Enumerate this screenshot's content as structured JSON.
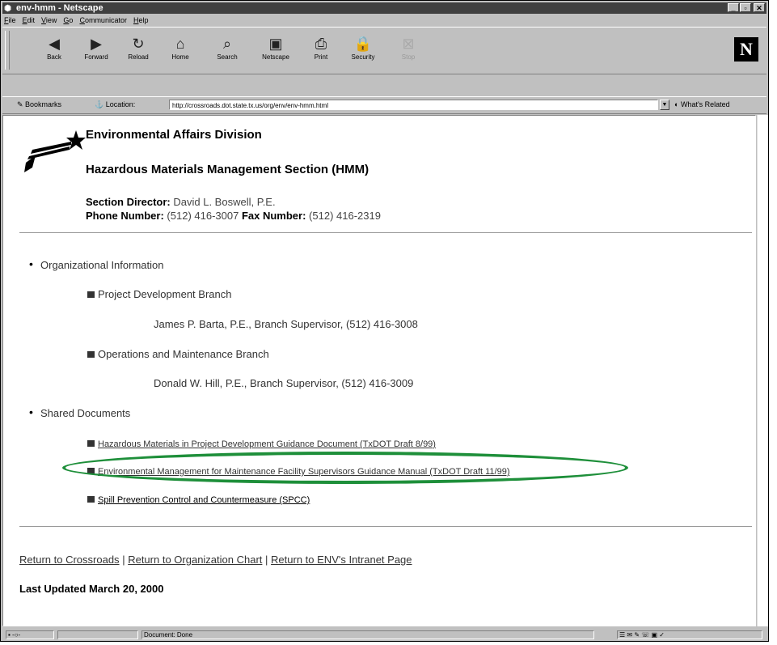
{
  "window": {
    "title": "env-hmm - Netscape",
    "controls": {
      "minimize": "_",
      "maximize": "▫",
      "close": "✕"
    }
  },
  "menu": [
    "File",
    "Edit",
    "View",
    "Go",
    "Communicator",
    "Help"
  ],
  "toolbar": [
    {
      "label": "Back",
      "icon": "◀"
    },
    {
      "label": "Forward",
      "icon": "▶"
    },
    {
      "label": "Reload",
      "icon": "↻"
    },
    {
      "label": "Home",
      "icon": "⌂"
    },
    {
      "label": "Search",
      "icon": "⌕"
    },
    {
      "label": "Netscape",
      "icon": "▣"
    },
    {
      "label": "Print",
      "icon": "⎙"
    },
    {
      "label": "Security",
      "icon": "🔒"
    },
    {
      "label": "Stop",
      "icon": "⊠"
    }
  ],
  "logo": "N",
  "location": {
    "bookmarks_label": "Bookmarks",
    "location_label": "Location:",
    "url": "http://crossroads.dot.state.tx.us/org/env/env-hmm.html",
    "whats_related": "What's Related"
  },
  "page": {
    "division": "Environmental Affairs Division",
    "section": "Hazardous Materials Management Section (HMM)",
    "director_label": "Section Director:",
    "director": "David L. Boswell, P.E.",
    "phone_label": "Phone Number:",
    "phone": "(512) 416-3007",
    "fax_label": "Fax Number:",
    "fax": "(512) 416-2319",
    "org_info": "Organizational Information",
    "branch1": "Project Development Branch",
    "branch1_contact": "James P. Barta, P.E., Branch Supervisor, (512) 416-3008",
    "branch2": "Operations and Maintenance Branch",
    "branch2_contact": "Donald W. Hill, P.E., Branch Supervisor, (512) 416-3009",
    "shared_docs": "Shared Documents",
    "doc1": "Hazardous Materials in Project Development Guidance Document (TxDOT Draft 8/99)",
    "doc2": "Environmental Management for Maintenance Facility Supervisors Guidance Manual (TxDOT Draft 11/99)",
    "doc3": "Spill Prevention Control and Countermeasure (SPCC)",
    "footer_link1": "Return to Crossroads",
    "footer_link2": "Return to Organization Chart",
    "footer_link3": "Return to ENV's Intranet Page",
    "separator": "|",
    "last_updated": "Last Updated March 20, 2000"
  },
  "status": {
    "text": "Document: Done"
  },
  "colors": {
    "highlight_ellipse": "#1e8f3a"
  }
}
